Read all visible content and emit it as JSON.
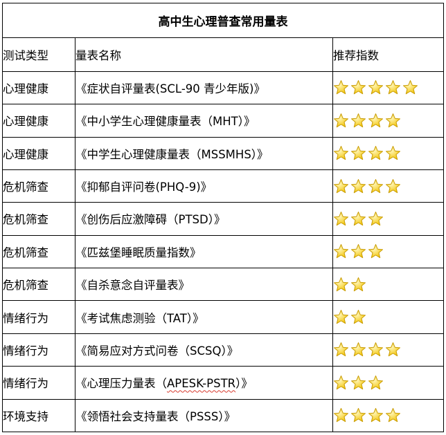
{
  "table": {
    "title": "高中生心理普查常用量表",
    "headers": [
      "测试类型",
      "量表名称",
      "推荐指数"
    ],
    "rows": [
      {
        "type": "心理健康",
        "name": "《症状自评量表(SCL-90 青少年版)》",
        "stars": 5
      },
      {
        "type": "心理健康",
        "name": "《中小学生心理健康量表（MHT）》",
        "stars": 4
      },
      {
        "type": "心理健康",
        "name": "《中学生心理健康量表（MSSMHS）》",
        "stars": 4
      },
      {
        "type": "危机筛查",
        "name": "《抑郁自评问卷(PHQ-9)》",
        "stars": 4
      },
      {
        "type": "危机筛查",
        "name": "《创伤后应激障碍（PTSD）》",
        "stars": 3
      },
      {
        "type": "危机筛查",
        "name": "《匹兹堡睡眠质量指数》",
        "stars": 3
      },
      {
        "type": "危机筛查",
        "name": "《自杀意念自评量表》",
        "stars": 2
      },
      {
        "type": "情绪行为",
        "name": "《考试焦虑测验（TAT）》",
        "stars": 2
      },
      {
        "type": "情绪行为",
        "name": "《简易应对方式问卷（SCSQ）》",
        "stars": 4
      },
      {
        "type": "情绪行为",
        "name_parts": [
          "《心理压力量表（",
          "APESK-PSTR",
          "）》"
        ],
        "stars": 3
      },
      {
        "type": "环境支持",
        "name": "《领悟社会支持量表（PSSS）》",
        "stars": 4
      }
    ]
  },
  "colors": {
    "border": "#000000",
    "star_fill_light": "#fff6b8",
    "star_fill_dark": "#f2c200",
    "star_stroke": "#c79a00",
    "spellcheck_underline": "#d83a2e"
  },
  "icons": {
    "rating": "star-icon"
  }
}
